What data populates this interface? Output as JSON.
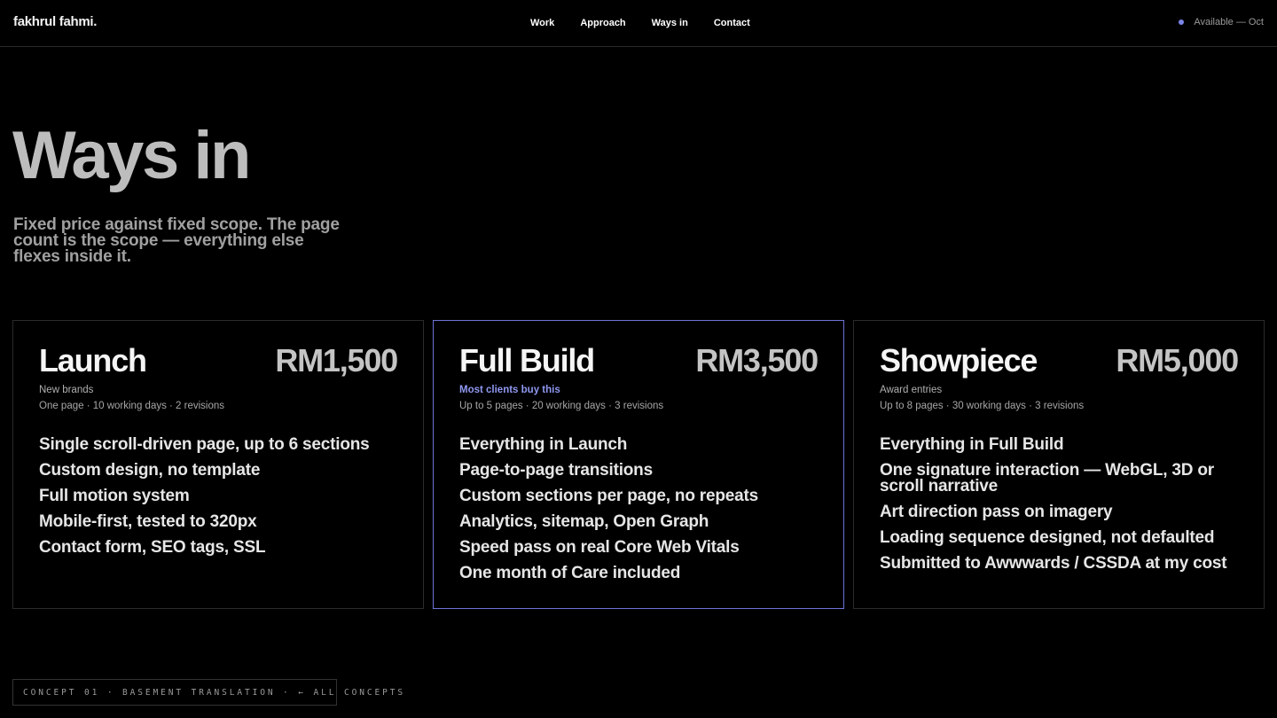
{
  "header": {
    "logo": "fakhrul fahmi.",
    "nav": [
      "Work",
      "Approach",
      "Ways in",
      "Contact"
    ],
    "status": "Available — Oct",
    "status_color": "#7b86e8"
  },
  "hero": {
    "title": "Ways in",
    "lede": "Fixed price against fixed scope. The page count is the scope — everything else flexes inside it."
  },
  "plans": [
    {
      "name": "Launch",
      "price": "RM1,500",
      "tag": "New brands",
      "meta": "One page · 10 working days · 2 revisions",
      "features": [
        "Single scroll-driven page, up to 6 sections",
        "Custom design, no template",
        "Full motion system",
        "Mobile-first, tested to 320px",
        "Contact form, SEO tags, SSL"
      ]
    },
    {
      "name": "Full Build",
      "price": "RM3,500",
      "tag": "Most clients buy this",
      "meta": "Up to 5 pages · 20 working days · 3 revisions",
      "features": [
        "Everything in Launch",
        "Page-to-page transitions",
        "Custom sections per page, no repeats",
        "Analytics, sitemap, Open Graph",
        "Speed pass on real Core Web Vitals",
        "One month of Care included"
      ]
    },
    {
      "name": "Showpiece",
      "price": "RM5,000",
      "tag": "Award entries",
      "meta": "Up to 8 pages · 30 working days · 3 revisions",
      "features": [
        "Everything in Full Build",
        "One signature interaction — WebGL, 3D or scroll narrative",
        "Art direction pass on imagery",
        "Loading sequence designed, not defaulted",
        "Submitted to Awwwards / CSSDA at my cost"
      ]
    }
  ],
  "accent_color": "#6c74d6",
  "footer": {
    "chip": "CONCEPT 01 · BASEMENT TRANSLATION · ← ALL CONCEPTS"
  }
}
